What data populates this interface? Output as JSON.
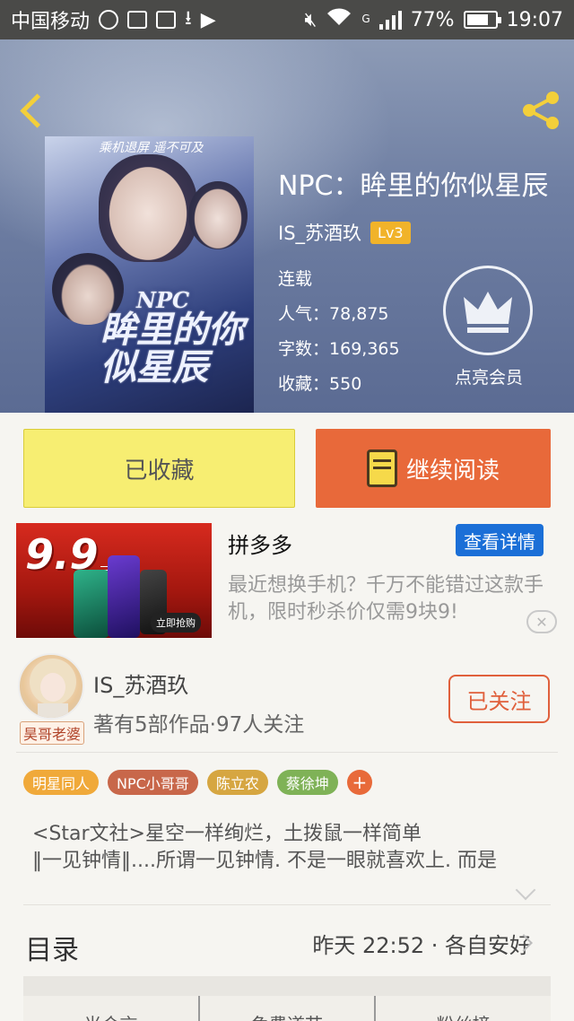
{
  "status_bar": {
    "carrier": "中国移动",
    "battery_percent": "77%",
    "time": "19:07",
    "network": "G",
    "icons": [
      "wechat-icon",
      "gallery-icon",
      "sim-icon",
      "download-icon",
      "media-icon",
      "mute-icon",
      "wifi-icon",
      "signal-icon",
      "battery-icon"
    ]
  },
  "header": {
    "book_title": "NPC：眸里的你似星辰",
    "author": "IS_苏酒玖",
    "level": "Lv3",
    "status": "连载",
    "popularity_label": "人气：",
    "popularity": "78,875",
    "words_label": "字数：",
    "words": "169,365",
    "favorites_label": "收藏：",
    "favorites": "550",
    "vip_label": "点亮会员",
    "cover": {
      "tag": "乘机退屏 遥不可及",
      "title_en": "NPC",
      "title_cn": "眸里的你似星辰"
    }
  },
  "actions": {
    "collected_label": "已收藏",
    "read_label": "继续阅读"
  },
  "ad": {
    "price": "9.9",
    "price_unit": "元",
    "cta": "立即抢购",
    "brand": "拼多多",
    "detail_label": "查看详情",
    "description": "最近想换手机？千万不能错过这款手机，限时秒杀价仅需9块9!",
    "close": "✕"
  },
  "author_section": {
    "name": "IS_苏酒玖",
    "meta": "著有5部作品·97人关注",
    "avatar_tag": "昊哥老婆",
    "follow_label": "已关注"
  },
  "tags": [
    {
      "label": "明星同人",
      "color": "#f0a93a"
    },
    {
      "label": "NPC小哥哥",
      "color": "#c8674a"
    },
    {
      "label": "陈立农",
      "color": "#d6a641"
    },
    {
      "label": "蔡徐坤",
      "color": "#7fb257"
    }
  ],
  "tag_add": "+",
  "description": {
    "line1": "<Star文社>星空一样绚烂，土拨鼠一样简单",
    "line2": "‖一见钟情‖....所谓一见钟情. 不是一眼就喜欢上. 而是"
  },
  "toc": {
    "title": "目录",
    "latest": "昨天 22:52 · 各自安好"
  },
  "bottom_tabs": [
    "光合言",
    "免费道节",
    "粉丝榜"
  ],
  "colors": {
    "accent_orange": "#e8693a",
    "collected_yellow": "#f7ee72",
    "ad_blue": "#1b6fd7",
    "follow_red": "#e0603c"
  }
}
